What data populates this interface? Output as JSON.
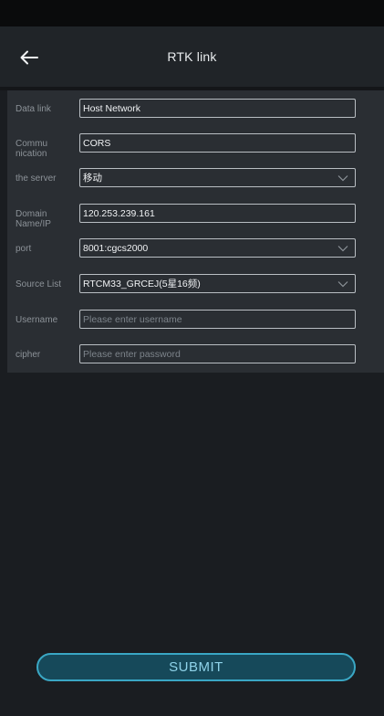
{
  "header": {
    "title": "RTK link",
    "back_icon": "arrow-left-icon"
  },
  "form": {
    "data_link": {
      "label": "Data link",
      "value": "Host Network"
    },
    "communication": {
      "label_line1": "Commu",
      "label_line2": "nication",
      "value": "CORS"
    },
    "server": {
      "label": "the server",
      "value": "移动"
    },
    "domain": {
      "label_line1": "Domain",
      "label_line2": "Name/IP",
      "value": "120.253.239.161"
    },
    "port": {
      "label": "port",
      "value": "8001:cgcs2000"
    },
    "source_list": {
      "label": "Source List",
      "value": "RTCM33_GRCEJ(5星16频)"
    },
    "username": {
      "label": "Username",
      "value": "",
      "placeholder": "Please enter username"
    },
    "cipher": {
      "label": "cipher",
      "value": "",
      "placeholder": "Please enter password"
    }
  },
  "submit": {
    "label": "SUBMIT"
  },
  "colors": {
    "background": "#1a1d21",
    "panel": "#2a2e33",
    "accent": "#3aa7c4",
    "submit_fill": "#16495a"
  }
}
